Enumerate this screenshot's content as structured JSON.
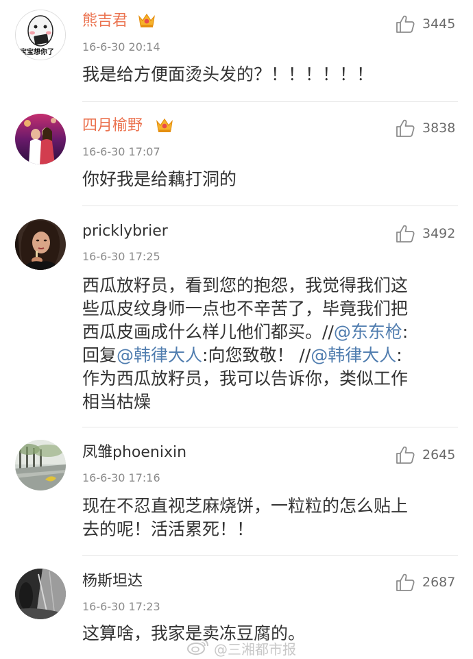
{
  "comments": [
    {
      "username": "熊吉君",
      "vip": true,
      "timestamp": "16-6-30 20:14",
      "likes": "3445",
      "avatar_caption": "宝宝想你了",
      "lines": [
        "我是给方便面烫头发的？！！！！！！"
      ]
    },
    {
      "username": "四月榆野",
      "vip": true,
      "timestamp": "16-6-30 17:07",
      "likes": "3838",
      "lines": [
        "你好我是给藕打洞的"
      ]
    },
    {
      "username": "pricklybrier",
      "vip": false,
      "timestamp": "16-6-30 17:25",
      "likes": "3492",
      "lines": [
        "西瓜放籽员，看到您的抱怨，我觉得我们这",
        "些瓜皮纹身师一点也不辛苦了，毕竟我们把",
        "西瓜皮画成什么样儿他们都买。//",
        "回复",
        "作为西瓜放籽员，我可以告诉你，类似工作",
        "相当枯燥"
      ],
      "mention_1": "@东东枪",
      "after_mention_1": ":",
      "mention_2": "@韩律大人",
      "between_mentions": ":向您致敬！ //",
      "mention_3": "@韩律大人",
      "after_mention_3": ":"
    },
    {
      "username": "凤雏phoenixin",
      "vip": false,
      "timestamp": "16-6-30 17:16",
      "likes": "2645",
      "lines": [
        "现在不忍直视芝麻烧饼，一粒粒的怎么贴上",
        "去的呢！活活累死！！"
      ]
    },
    {
      "username": "杨斯坦达",
      "vip": false,
      "timestamp": "16-6-30 17:23",
      "likes": "2687",
      "lines": [
        "这算啥，我家是卖冻豆腐的。"
      ]
    }
  ],
  "watermark": "@三湘都市报",
  "colors": {
    "vip_name": "#eb7350",
    "mention": "#507daf",
    "text": "#333333",
    "meta": "#8a8a8a"
  }
}
